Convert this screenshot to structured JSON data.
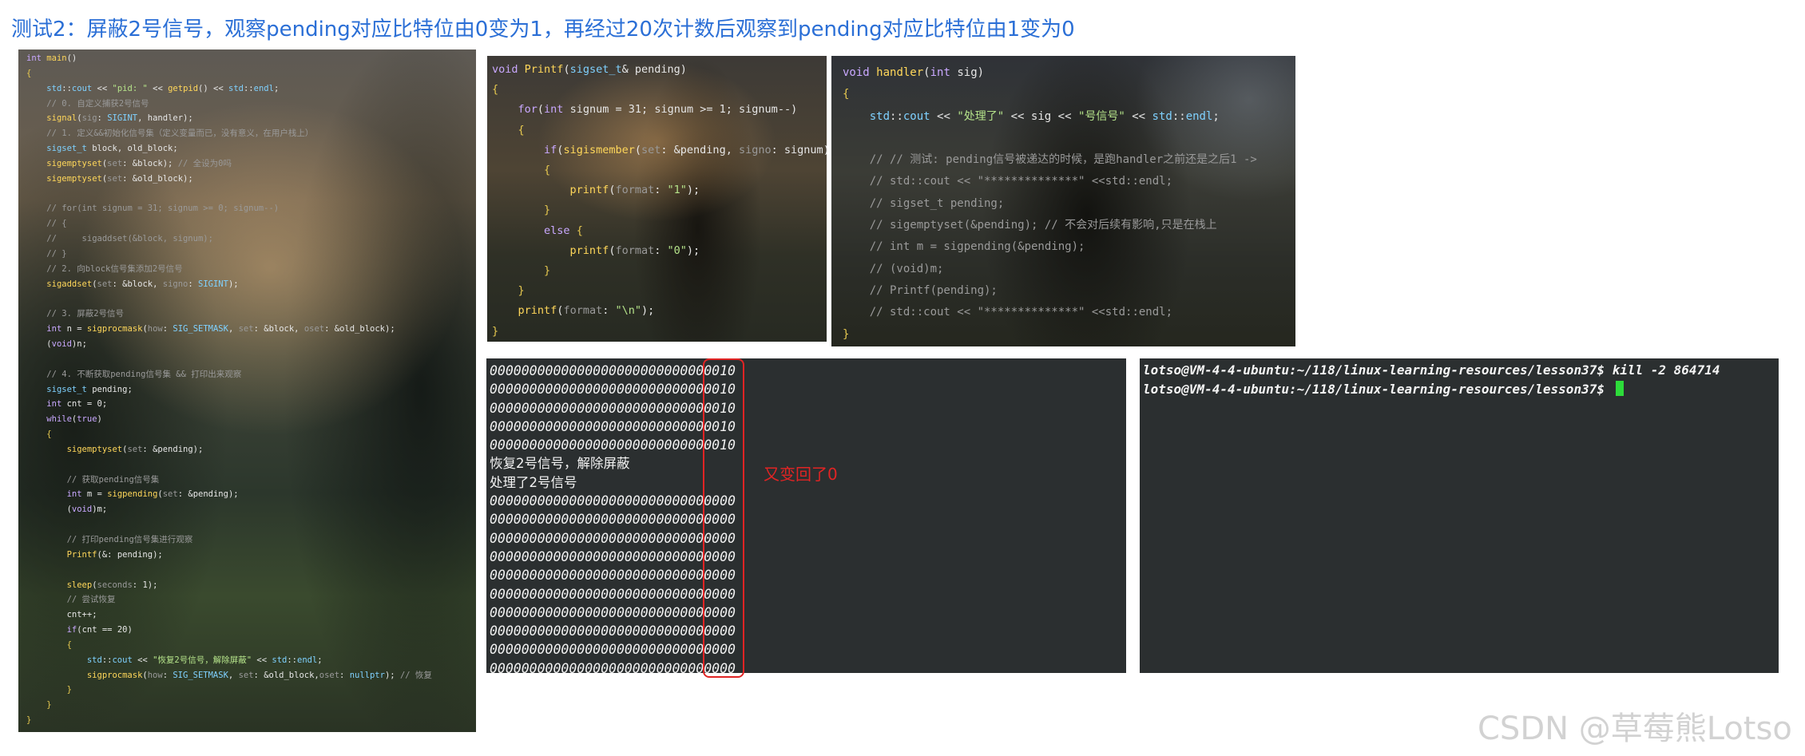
{
  "heading": "测试2：屏蔽2号信号，观察pending对应比特位由0变为1，再经过20次计数后观察到pending对应比特位由1变为0",
  "colors": {
    "keyword": "#c9a8ff",
    "function": "#ffd75a",
    "type": "#7fd1ff",
    "string": "#b5e38a",
    "comment": "#9a9a9a",
    "text": "#e6e6e6",
    "brace": "#e6c84f",
    "annotation_red": "#e02424",
    "terminal_bg": "#2b2f30",
    "cursor": "#2ddc3a"
  },
  "code_main": {
    "lines": [
      "int main()",
      "{",
      "    std::cout << \"pid: \" << getpid() << std::endl;",
      "    // 0. 自定义捕获2号信号",
      "    signal(sig: SIGINT, handler);",
      "    // 1. 定义&&初始化信号集（定义变量而已，没有意义，在用户栈上）",
      "    sigset_t block, old_block;",
      "    sigemptyset(set: &block); // 全设为0吗",
      "    sigemptyset(set: &old_block);",
      "",
      "    // for(int signum = 31; signum >= 0; signum--)",
      "    // {",
      "    //     sigaddset(&block, signum);",
      "    // }",
      "    // 2. 向block信号集添加2号信号",
      "    sigaddset(set: &block, signo: SIGINT);",
      "",
      "    // 3. 屏蔽2号信号",
      "    int n = sigprocmask(how: SIG_SETMASK, set: &block, oset: &old_block);",
      "    (void)n;",
      "",
      "    // 4. 不断获取pending信号集 && 打印出来观察",
      "    sigset_t pending;",
      "    int cnt = 0;",
      "    while(true)",
      "    {",
      "        sigemptyset(set: &pending);",
      "",
      "        // 获取pending信号集",
      "        int m = sigpending(set: &pending);",
      "        (void)m;",
      "",
      "        // 打印pending信号集进行观察",
      "        Printf(&: pending);",
      "",
      "        sleep(seconds: 1);",
      "        // 尝试恢复",
      "        cnt++;",
      "        if(cnt == 20)",
      "        {",
      "            std::cout << \"恢复2号信号，解除屏蔽\" << std::endl;",
      "            sigprocmask(how: SIG_SETMASK, set: &old_block,oset: nullptr); // 恢复",
      "        }",
      "    }",
      "}"
    ]
  },
  "code_printf": {
    "lines": [
      "void Printf(sigset_t& pending)",
      "{",
      "    for(int signum = 31; signum >= 1; signum--)",
      "    {",
      "        if(sigismember(set: &pending, signo: signum))",
      "        {",
      "            printf(format: \"1\");",
      "        }",
      "        else {",
      "            printf(format: \"0\");",
      "        }",
      "    }",
      "    printf(format: \"\\n\");",
      "}"
    ]
  },
  "code_handler": {
    "lines": [
      "void handler(int sig)",
      "{",
      "    std::cout << \"处理了\" << sig << \"号信号\" << std::endl;",
      "",
      "    // // 测试: pending信号被递达的时候，是跑handler之前还是之后1 ->",
      "    // std::cout << \"**************\" <<std::endl;",
      "    // sigset_t pending;",
      "    // sigemptyset(&pending); // 不会对后续有影响,只是在栈上",
      "    // int m = sigpending(&pending);",
      "    // (void)m;",
      "    // Printf(pending);",
      "    // std::cout << \"**************\" <<std::endl;",
      "}"
    ]
  },
  "terminal_output": {
    "lines": [
      "0000000000000000000000000000010",
      "0000000000000000000000000000010",
      "0000000000000000000000000000010",
      "0000000000000000000000000000010",
      "0000000000000000000000000000010",
      "恢复2号信号，解除屏蔽",
      "处理了2号信号",
      "0000000000000000000000000000000",
      "0000000000000000000000000000000",
      "0000000000000000000000000000000",
      "0000000000000000000000000000000",
      "0000000000000000000000000000000",
      "0000000000000000000000000000000",
      "0000000000000000000000000000000",
      "0000000000000000000000000000000",
      "0000000000000000000000000000000",
      "0000000000000000000000000000000"
    ],
    "annotation": "又变回了0"
  },
  "terminal_shell": {
    "lines": [
      "lotso@VM-4-4-ubuntu:~/118/linux-learning-resources/lesson37$ kill -2 864714",
      "lotso@VM-4-4-ubuntu:~/118/linux-learning-resources/lesson37$ "
    ]
  },
  "watermark": "CSDN @草莓熊Lotso"
}
